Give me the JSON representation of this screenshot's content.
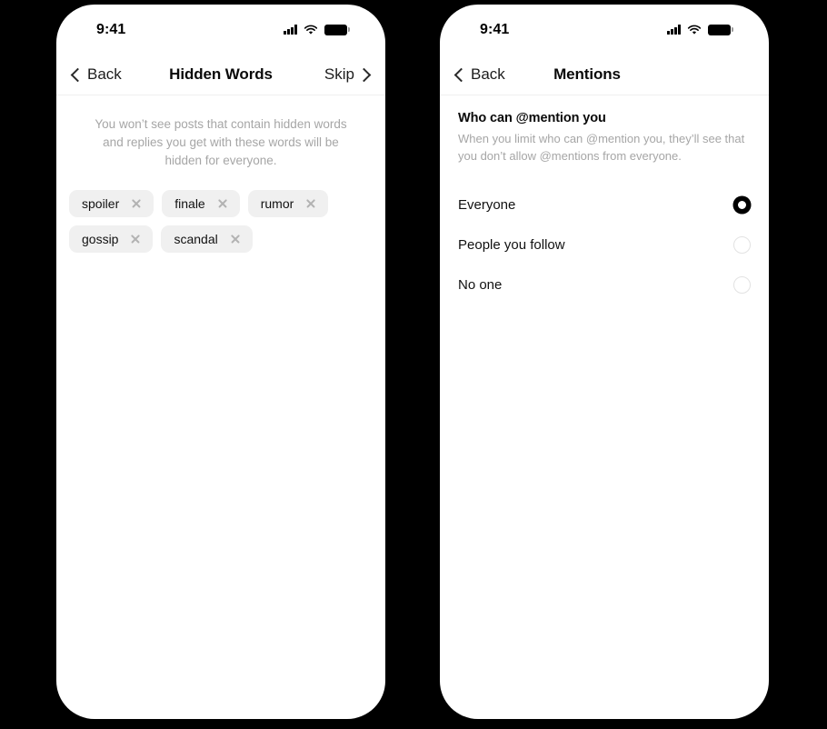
{
  "phones": [
    {
      "id": "hidden-words",
      "status_bar": {
        "time": "9:41",
        "signal_icon": "cellular-signal-icon",
        "wifi_icon": "wifi-icon",
        "battery_icon": "battery-icon"
      },
      "nav": {
        "back_label": "Back",
        "title": "Hidden Words",
        "action_label": "Skip",
        "back_icon": "chevron-left-icon",
        "action_icon": "chevron-right-icon"
      },
      "description": "You won’t see posts that contain hidden words and replies you get with these words will be hidden for everyone.",
      "chips": [
        {
          "label": "spoiler",
          "remove_icon": "close-icon"
        },
        {
          "label": "finale",
          "remove_icon": "close-icon"
        },
        {
          "label": "rumor",
          "remove_icon": "close-icon"
        },
        {
          "label": "gossip",
          "remove_icon": "close-icon"
        },
        {
          "label": "scandal",
          "remove_icon": "close-icon"
        }
      ]
    },
    {
      "id": "mentions",
      "status_bar": {
        "time": "9:41",
        "signal_icon": "cellular-signal-icon",
        "wifi_icon": "wifi-icon",
        "battery_icon": "battery-icon"
      },
      "nav": {
        "back_label": "Back",
        "title": "Mentions",
        "back_icon": "chevron-left-icon"
      },
      "section": {
        "heading": "Who can @mention you",
        "subtext": "When you limit who can @mention you, they’ll see that you don’t allow @mentions from everyone."
      },
      "options": [
        {
          "label": "Everyone",
          "selected": true
        },
        {
          "label": "People you follow",
          "selected": false
        },
        {
          "label": "No one",
          "selected": false
        }
      ]
    }
  ],
  "colors": {
    "background": "#000000",
    "screen": "#ffffff",
    "text_primary": "#111111",
    "text_muted": "#a6a6a6",
    "chip_background": "#f0f0f0",
    "radio_off_border": "#e2e2e2",
    "radio_on": "#000000"
  }
}
